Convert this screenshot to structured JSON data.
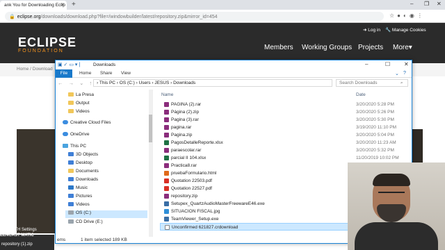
{
  "browser": {
    "tab_title": "ank You for Downloading Eclip",
    "url_host": "eclipse.org",
    "url_path": "/downloads/download.php?file=/windowbuilder/latest/repository.zip&mirror_id=454"
  },
  "site": {
    "login": "Log in",
    "manage_cookies": "Manage Cookies",
    "logo_main": "ECLIPSE",
    "logo_sub": "FOUNDATION",
    "nav": [
      "Members",
      "Working Groups",
      "Projects",
      "More"
    ],
    "breadcrumb": "Home / Download"
  },
  "explorer": {
    "title": "Downloads",
    "ribbon_tabs": [
      "File",
      "Home",
      "Share",
      "View"
    ],
    "breadcrumb": [
      "This PC",
      "OS (C:)",
      "Users",
      "JESUS",
      "Downloads"
    ],
    "search_placeholder": "Search Downloads",
    "column_name": "Name",
    "column_date": "Date",
    "nav_items": [
      {
        "label": "La Presa",
        "icon": "folder-icon"
      },
      {
        "label": "Output",
        "icon": "folder-icon"
      },
      {
        "label": "Videos",
        "icon": "folder-icon"
      },
      {
        "label": "Creative Cloud Files",
        "icon": "cloud-icon"
      },
      {
        "label": "OneDrive",
        "icon": "cloud-icon"
      },
      {
        "label": "This PC",
        "icon": "pc-icon"
      },
      {
        "label": "3D Objects",
        "icon": "folder-icon"
      },
      {
        "label": "Desktop",
        "icon": "folder-icon"
      },
      {
        "label": "Documents",
        "icon": "folder-icon"
      },
      {
        "label": "Downloads",
        "icon": "download-icon"
      },
      {
        "label": "Music",
        "icon": "music-icon"
      },
      {
        "label": "Pictures",
        "icon": "folder-icon"
      },
      {
        "label": "Videos",
        "icon": "folder-icon"
      },
      {
        "label": "OS (C:)",
        "icon": "drive-icon"
      },
      {
        "label": "CD Drive (E:)",
        "icon": "drive-icon"
      }
    ],
    "files": [
      {
        "name": "PAGINA (2).rar",
        "date": "3/20/2020 5:28 PM",
        "type": "rar"
      },
      {
        "name": "Página (2).zip",
        "date": "3/20/2020 5:26 PM",
        "type": "zip"
      },
      {
        "name": "Pagina (3).rar",
        "date": "3/20/2020 5:30 PM",
        "type": "rar"
      },
      {
        "name": "pagina.rar",
        "date": "3/19/2020 11:10 PM",
        "type": "rar"
      },
      {
        "name": "Pagina.zip",
        "date": "3/20/2020 5:04 PM",
        "type": "zip"
      },
      {
        "name": "PagosDetalleReporte.xlsx",
        "date": "3/20/2020 11:23 AM",
        "type": "xlsx"
      },
      {
        "name": "paraescolar.rar",
        "date": "3/20/2020 5:32 PM",
        "type": "rar"
      },
      {
        "name": "parcial II 104.xlsx",
        "date": "11/20/2019 10:02 PM",
        "type": "xlsx"
      },
      {
        "name": "Practica8.rar",
        "date": "",
        "type": "rar"
      },
      {
        "name": "pruebaFormulario.html",
        "date": "",
        "type": "html"
      },
      {
        "name": "Quotation 22503.pdf",
        "date": "",
        "type": "pdf"
      },
      {
        "name": "Quotation 22527.pdf",
        "date": "",
        "type": "pdf"
      },
      {
        "name": "repository.zip",
        "date": "",
        "type": "zip"
      },
      {
        "name": "Setupex_QuartzAudioMasterFreewareE46.exe",
        "date": "",
        "type": "exe"
      },
      {
        "name": "SITUACION FISCAL.jpg",
        "date": "",
        "type": "jpg"
      },
      {
        "name": "TeamViewer_Setup.exe",
        "date": "",
        "type": "exe"
      },
      {
        "name": "Unconfirmed 621827.crdownload",
        "date": "",
        "type": "crd"
      }
    ],
    "status_items": "ems",
    "status_selected": "1 item selected  189 KB"
  },
  "overlay": {
    "shelf_line1": "PED WITH",
    "shelf_line2": "EENCAST",
    "shelf_line3": "MATIC",
    "shelf_settings": "Settings",
    "shelf_file": "repository (1).zip"
  }
}
